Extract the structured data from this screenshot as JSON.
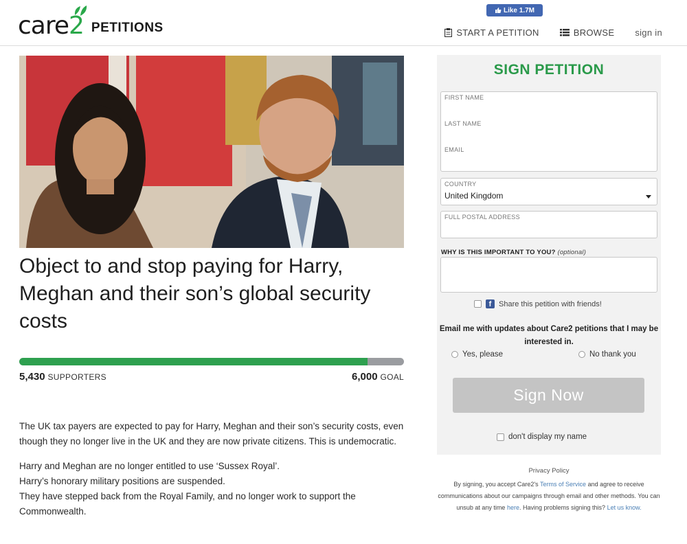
{
  "header": {
    "fb_like": "Like 1.7M",
    "logo_text": "care",
    "logo_two": "2",
    "brand_suffix": "PETITIONS",
    "nav": {
      "start": "START A PETITION",
      "browse": "BROWSE",
      "signin": "sign in"
    }
  },
  "petition": {
    "title": "Object to and stop paying for Harry, Meghan and their son’s global security costs",
    "supporters_count": "5,430",
    "supporters_label": "SUPPORTERS",
    "goal_count": "6,000",
    "goal_label": "GOAL",
    "progress_fraction": 0.905,
    "body": {
      "p1": "The UK tax payers are expected to pay for Harry, Meghan and their son’s security costs, even though they no longer live in the UK and they are now private citizens. This is undemocratic.",
      "p2_line1": "Harry and Meghan are no longer entitled to use ‘Sussex Royal’.",
      "p2_line2": "Harry’s honorary military positions are suspended.",
      "p2_line3": "They have stepped back from the Royal Family, and no longer work to support the Commonwealth."
    }
  },
  "sign_form": {
    "title": "SIGN PETITION",
    "first_name_label": "FIRST NAME",
    "last_name_label": "LAST NAME",
    "email_label": "EMAIL",
    "country_label": "COUNTRY",
    "country_value": "United Kingdom",
    "address_label": "FULL POSTAL ADDRESS",
    "why_label": "WHY IS THIS IMPORTANT TO YOU?",
    "why_optional": "(optional)",
    "share_label": "Share this petition with friends!",
    "email_question": "Email me with updates about Care2 petitions that I may be interested in.",
    "yes_label": "Yes, please",
    "no_label": "No thank you",
    "submit_label": "Sign Now",
    "hide_name_label": "don't display my name",
    "privacy": "Privacy Policy",
    "legal_1": "By signing, you accept Care2's",
    "legal_tos": "Terms of Service",
    "legal_2": "and agree to receive communications about our campaigns through email and other methods. You can unsub at any time",
    "legal_here": "here",
    "legal_3": "Having problems signing this?",
    "legal_contact": "Let us know."
  },
  "colors": {
    "brand_green": "#2aa84a",
    "progress_fill": "#2ea04f",
    "progress_track": "#9a9ca0",
    "button_disabled": "#c4c4c4",
    "facebook": "#4267b2"
  }
}
